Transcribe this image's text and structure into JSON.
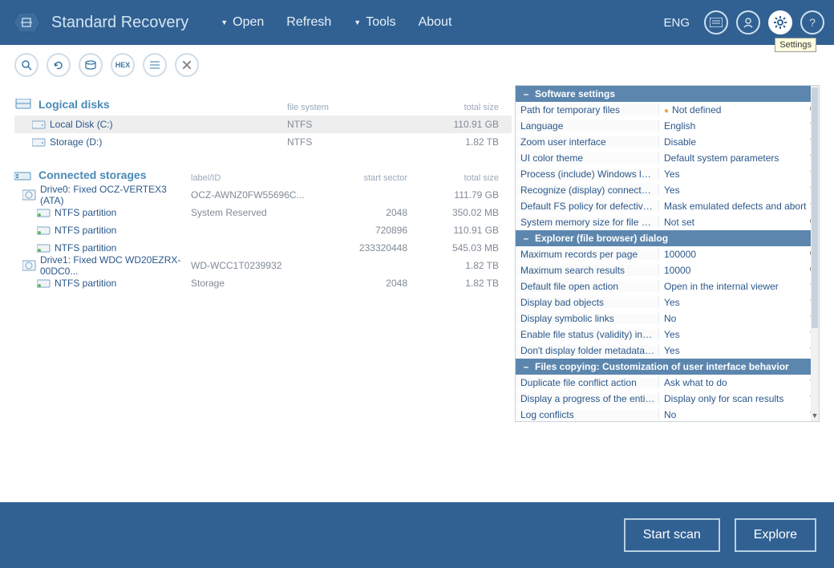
{
  "header": {
    "title": "Standard Recovery",
    "menu": {
      "open": "Open",
      "refresh": "Refresh",
      "tools": "Tools",
      "about": "About"
    },
    "lang": "ENG",
    "tooltip": "Settings"
  },
  "sections": {
    "logical": {
      "title": "Logical disks",
      "cols": {
        "fs": "file system",
        "size": "total size"
      },
      "rows": [
        {
          "name": "Local Disk (C:)",
          "fs": "NTFS",
          "size": "110.91 GB",
          "selected": true
        },
        {
          "name": "Storage (D:)",
          "fs": "NTFS",
          "size": "1.82 TB",
          "selected": false
        }
      ]
    },
    "connected": {
      "title": "Connected storages",
      "cols": {
        "label": "label/ID",
        "sector": "start sector",
        "size": "total size"
      },
      "drives": [
        {
          "name": "Drive0: Fixed OCZ-VERTEX3 (ATA)",
          "label": "OCZ-AWNZ0FW55696C...",
          "sector": "",
          "size": "111.79 GB",
          "parts": [
            {
              "name": "NTFS partition",
              "label": "System Reserved",
              "sector": "2048",
              "size": "350.02 MB"
            },
            {
              "name": "NTFS partition",
              "label": "",
              "sector": "720896",
              "size": "110.91 GB"
            },
            {
              "name": "NTFS partition",
              "label": "",
              "sector": "233320448",
              "size": "545.03 MB"
            }
          ]
        },
        {
          "name": "Drive1: Fixed WDC WD20EZRX-00DC0...",
          "label": "WD-WCC1T0239932",
          "sector": "",
          "size": "1.82 TB",
          "parts": [
            {
              "name": "NTFS partition",
              "label": "Storage",
              "sector": "2048",
              "size": "1.82 TB"
            }
          ]
        }
      ]
    }
  },
  "settings": {
    "groups": [
      {
        "title": "Software settings",
        "rows": [
          {
            "key": "Path for temporary files",
            "val": "Not defined",
            "arrow": "▸",
            "bullet": true
          },
          {
            "key": "Language",
            "val": "English",
            "arrow": "▾"
          },
          {
            "key": "Zoom user interface",
            "val": "Disable",
            "arrow": "▾"
          },
          {
            "key": "UI color theme",
            "val": "Default system parameters",
            "arrow": "▾"
          },
          {
            "key": "Process (include) Windows logical ...",
            "val": "Yes",
            "arrow": "▾"
          },
          {
            "key": "Recognize (display) connected me...",
            "val": "Yes",
            "arrow": "▾"
          },
          {
            "key": "Default FS policy for defective blo...",
            "val": "Mask emulated defects and abort",
            "arrow": "▾"
          },
          {
            "key": "System memory size for file cache...",
            "val": "Not set",
            "arrow": "▸"
          }
        ]
      },
      {
        "title": "Explorer (file browser) dialog",
        "rows": [
          {
            "key": "Maximum records per page",
            "val": "100000",
            "arrow": "▸"
          },
          {
            "key": "Maximum search results",
            "val": "10000",
            "arrow": "▸"
          },
          {
            "key": "Default file open action",
            "val": "Open in the internal viewer",
            "arrow": "▾"
          },
          {
            "key": "Display bad objects",
            "val": "Yes",
            "arrow": "▾"
          },
          {
            "key": "Display symbolic links",
            "val": "No",
            "arrow": "▾"
          },
          {
            "key": "Enable file status (validity) indicati...",
            "val": "Yes",
            "arrow": "▾"
          },
          {
            "key": "Don't display folder metadata size",
            "val": "Yes",
            "arrow": "▾"
          }
        ]
      },
      {
        "title": "Files copying: Customization of user interface behavior",
        "rows": [
          {
            "key": "Duplicate file conflict action",
            "val": "Ask what to do",
            "arrow": "▾"
          },
          {
            "key": "Display a progress of the entire c...",
            "val": "Display only for scan results",
            "arrow": "▾"
          },
          {
            "key": "Log conflicts",
            "val": "No",
            "arrow": "▾"
          }
        ]
      }
    ]
  },
  "footer": {
    "scan": "Start scan",
    "explore": "Explore"
  }
}
